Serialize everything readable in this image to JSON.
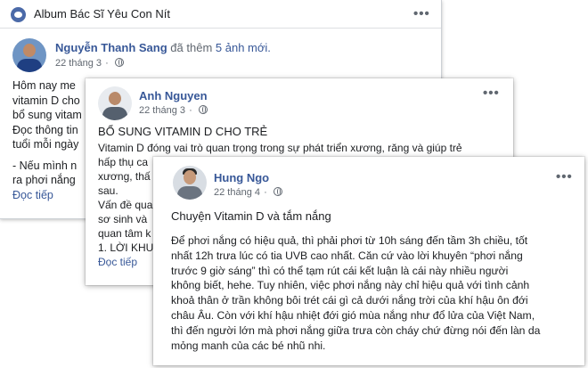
{
  "post1": {
    "group_name": "Album Bác Sĩ Yêu Con Nít",
    "author": "Nguyễn Thanh Sang",
    "action_prefix": "đã thêm",
    "action_link": "5 ảnh mới.",
    "date": "22 tháng 3",
    "separator": "·",
    "lines": [
      "Hôm nay me",
      "vitamin D cho",
      "bổ sung vitam",
      "Đọc thông tin",
      "tuổi mỗi ngày",
      "",
      "- Nếu mình n",
      "ra phơi nắng"
    ],
    "read_more": "Đọc tiếp"
  },
  "post2": {
    "author": "Anh Nguyen",
    "date": "22 tháng 3",
    "separator": "·",
    "title": "BỔ SUNG VITAMIN D CHO TRẺ",
    "lines": [
      "Vitamin D đóng vai trò quan trọng trong sự phát triển xương, răng và giúp trẻ",
      "hấp thụ ca",
      "xương, thấ",
      "sau.",
      "Vấn đề qua",
      "sơ sinh và",
      "quan tâm k",
      "1. LỜI KHU"
    ],
    "read_more": "Đọc tiếp"
  },
  "post3": {
    "author": "Hung Ngo",
    "date": "22 tháng 4",
    "separator": "·",
    "title": "Chuyện Vitamin D và tắm nắng",
    "lines": [
      "Để phơi nắng có hiệu quả, thì phải phơi từ 10h sáng đến tầm 3h chiều, tốt",
      "nhất 12h trưa lúc có tia UVB cao nhất. Căn cứ vào lời khuyên “phơi nắng",
      "trước 9 giờ sáng” thì có thể tạm rút cái kết luận là cái này nhiều người",
      "không biết, hehe. Tuy nhiên, việc phơi nắng này chỉ hiệu quả với tình cảnh",
      "khoả thân ở trần không bôi trét cái gì cả dưới nắng trời của khí hậu ôn đới",
      "châu Âu. Còn với khí hậu nhiệt đới gió mùa nắng như đổ lửa của Việt Nam,",
      "thì đến người lớn mà phơi nắng giữa trưa còn cháy chứ đừng nói đến làn da",
      "mỏng manh của các bé nhũ nhi."
    ]
  },
  "icons": {
    "more": "more-options-icon",
    "globe": "public-globe-icon",
    "group": "group-icon"
  },
  "colors": {
    "link": "#385898",
    "meta": "#606770",
    "text": "#1c1e21"
  }
}
